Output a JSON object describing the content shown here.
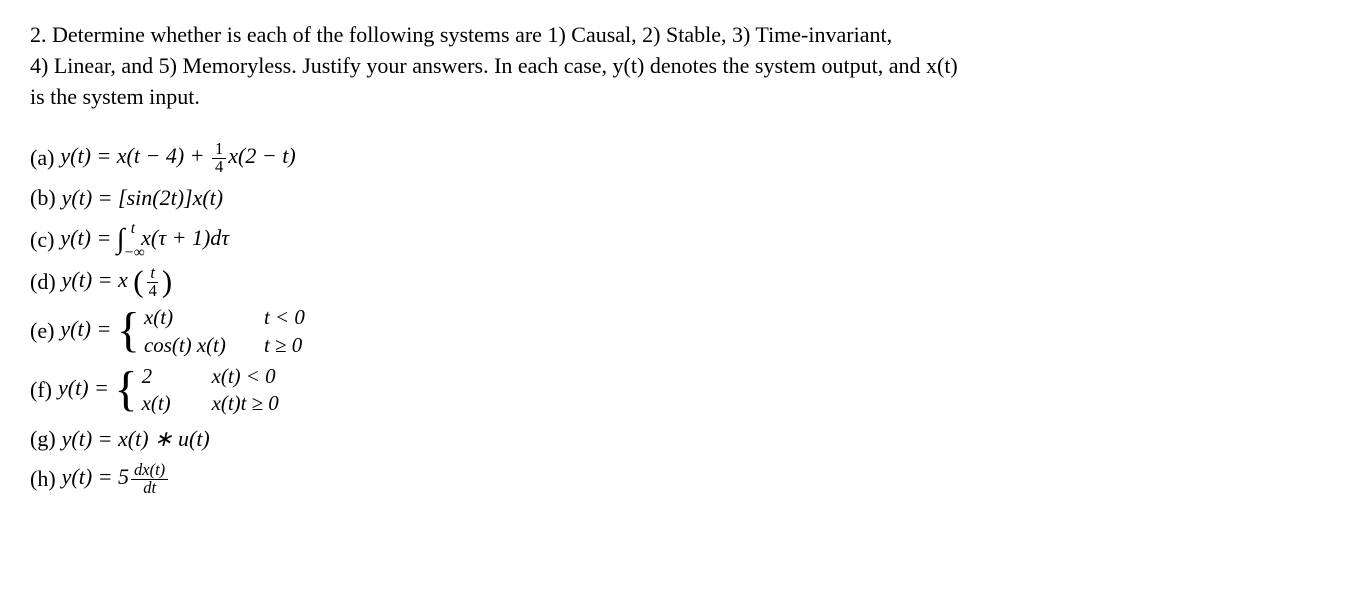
{
  "problem": {
    "number": "2.",
    "intro_line1": "Determine whether is each of the following systems are 1) Causal, 2) Stable, 3) Time-invariant,",
    "intro_line2": "4) Linear, and 5) Memoryless. Justify your answers. In each case, y(t) denotes the system output, and x(t)",
    "intro_line3": "is the system input."
  },
  "parts": {
    "a": {
      "label": "(a)",
      "lhs": "y(t) = ",
      "term1": "x(t − 4) + ",
      "frac_num": "1",
      "frac_den": "4",
      "term2": "x(2 − t)"
    },
    "b": {
      "label": "(b)",
      "expr": "y(t) = [sin(2t)]x(t)"
    },
    "c": {
      "label": "(c)",
      "lhs": "y(t) = ",
      "int_lower": "−∞",
      "int_upper": "t",
      "integrand": "x(τ + 1)dτ"
    },
    "d": {
      "label": "(d)",
      "lhs": "y(t) = x",
      "frac_num": "t",
      "frac_den": "4"
    },
    "e": {
      "label": "(e)",
      "lhs": "y(t) = ",
      "case1_val": "x(t)",
      "case1_cond": "t < 0",
      "case2_val": "cos(t) x(t)",
      "case2_cond": "t ≥ 0"
    },
    "f": {
      "label": "(f)",
      "lhs": "y(t) = ",
      "case1_val": "2",
      "case1_cond": "x(t) < 0",
      "case2_val": "x(t)",
      "case2_cond": "x(t)t ≥ 0"
    },
    "g": {
      "label": "(g)",
      "expr": "y(t) = x(t) ∗ u(t)"
    },
    "h": {
      "label": "(h)",
      "lhs": "y(t) = 5",
      "frac_num": "dx(t)",
      "frac_den": "dt"
    }
  }
}
